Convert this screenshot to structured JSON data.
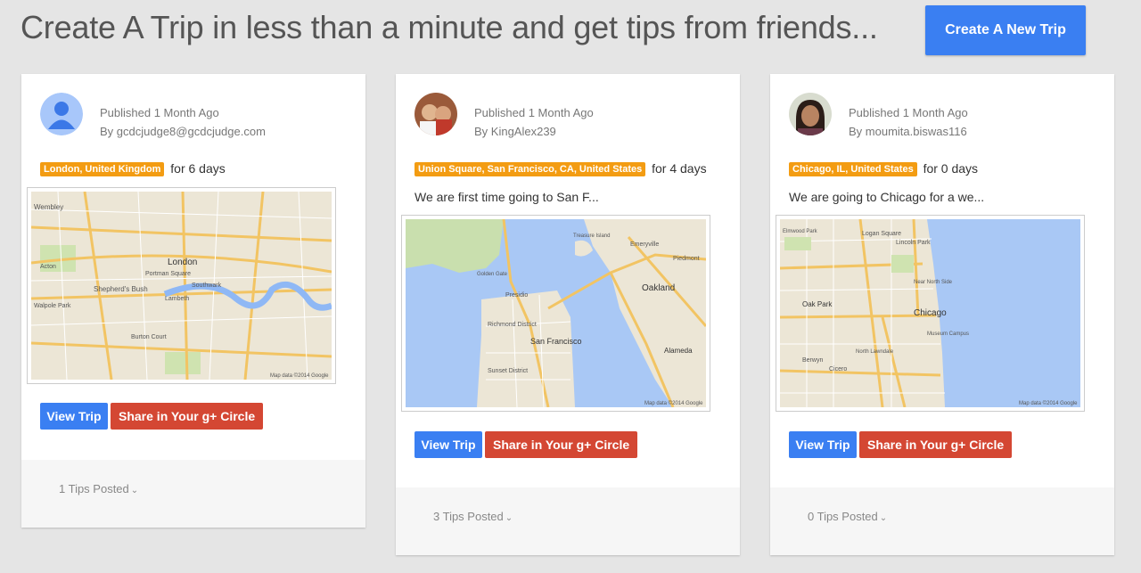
{
  "header": {
    "headline": "Create A Trip in less than a minute and get tips from friends...",
    "create_button": "Create A New Trip"
  },
  "trips": [
    {
      "published": "Published 1 Month Ago",
      "by": "By gcdcjudge8@gcdcjudge.com",
      "location": "London, United Kingdom",
      "duration": "for 6 days",
      "description": "",
      "map_labels": [
        "Wembley",
        "Shepherd's Bush",
        "Walpole Park",
        "Acton",
        "Portman Square",
        "London",
        "Lambeth",
        "Southwark",
        "Burton Court",
        "Map data ©2014 Google"
      ],
      "view_label": "View Trip",
      "share_label": "Share in Your g+ Circle",
      "tips": "1 Tips Posted"
    },
    {
      "published": "Published 1 Month Ago",
      "by": "By KingAlex239",
      "location": "Union Square, San Francisco, CA, United States",
      "duration": "for 4 days",
      "description": "We are first time going to San F...",
      "map_labels": [
        "Golden Gate",
        "Presidio",
        "Richmond District",
        "San Francisco",
        "Sunset District",
        "Treasure Island",
        "Oakland",
        "Alameda",
        "Emeryville",
        "Piedmont",
        "Map data ©2014 Google"
      ],
      "view_label": "View Trip",
      "share_label": "Share in Your g+ Circle",
      "tips": "3 Tips Posted"
    },
    {
      "published": "Published 1 Month Ago",
      "by": "By moumita.biswas116",
      "location": "Chicago, IL, United States",
      "duration": "for 0 days",
      "description": "We are going to Chicago for a we...",
      "map_labels": [
        "Elmwood Park",
        "Logan Square",
        "Lincoln Park",
        "Oak Park",
        "Chicago",
        "Berwyn",
        "Cicero",
        "North Lawndale",
        "Museum Campus",
        "Near North Side",
        "Map data ©2014 Google"
      ],
      "view_label": "View Trip",
      "share_label": "Share in Your g+ Circle",
      "tips": "0 Tips Posted"
    }
  ],
  "colors": {
    "primary_blue": "#3a7ff2",
    "share_red": "#d44733",
    "badge_orange": "#f39c12"
  }
}
